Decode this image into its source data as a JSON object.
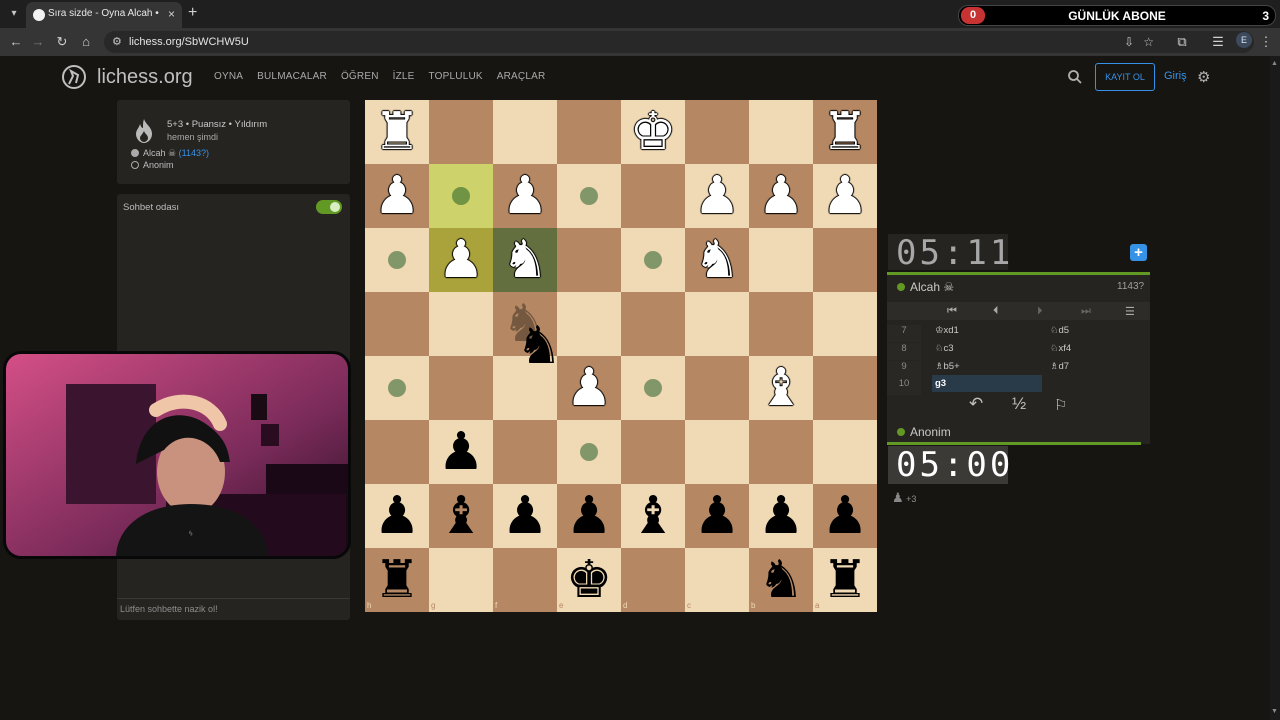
{
  "browser": {
    "tab_title": "Sıra sizde - Oyna Alcah • liches…",
    "url": "lichess.org/SbWCHW5U"
  },
  "overlay": {
    "left_count": "0",
    "label": "GÜNLÜK ABONE",
    "right_count": "3"
  },
  "header": {
    "logo": "lichess.org",
    "nav": [
      "OYNA",
      "BULMACALAR",
      "ÖĞREN",
      "İZLE",
      "TOPLULUK",
      "ARAÇLAR"
    ],
    "signup": "KAYIT OL",
    "signin": "Giriş"
  },
  "game_info": {
    "line1": "5+3 • Puansız • Yıldırım",
    "line2": "hemen şimdi",
    "player1_name": "Alcah ☠",
    "player1_rating": "(1143?)",
    "player2_name": "Anonim"
  },
  "chat": {
    "title": "Sohbet odası",
    "placeholder": "Lütfen sohbette nazik ol!"
  },
  "clocks": {
    "top": "05:11",
    "bottom": "05:00"
  },
  "players": {
    "top_name": "Alcah ☠",
    "top_rating": "1143?",
    "bottom_name": "Anonim",
    "bottom_extra": "+3"
  },
  "moves": [
    {
      "n": "7",
      "w": "♔xd1",
      "b": "♘d5"
    },
    {
      "n": "8",
      "w": "♘c3",
      "b": "♘xf4"
    },
    {
      "n": "9",
      "w": "♗b5+",
      "b": "♗d7"
    },
    {
      "n": "10",
      "w": "g3",
      "b": ""
    }
  ],
  "actions": {
    "takeback": "↶",
    "draw": "½",
    "resign": "⚐"
  },
  "board": {
    "rank_labels": [
      "1",
      "2",
      "3",
      "4",
      "5",
      "6",
      "7",
      "8"
    ],
    "file_labels": [
      "h",
      "g",
      "f",
      "e",
      "d",
      "c",
      "b",
      "a"
    ]
  }
}
